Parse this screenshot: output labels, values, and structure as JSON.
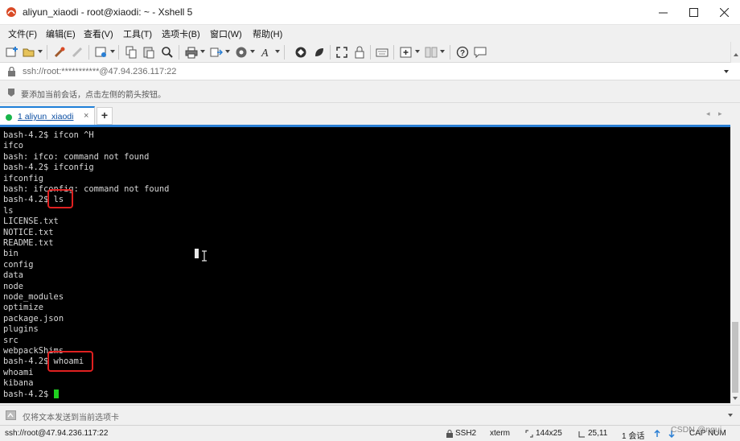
{
  "window": {
    "title": "aliyun_xiaodi - root@xiaodi: ~ - Xshell 5",
    "minimize_glyph": "—",
    "maximize_glyph": "☐",
    "close_glyph": "✕"
  },
  "menu": {
    "items": [
      "文件(F)",
      "编辑(E)",
      "查看(V)",
      "工具(T)",
      "选项卡(B)",
      "窗口(W)",
      "帮助(H)"
    ]
  },
  "toolbar": {
    "icons": [
      "new-session-icon",
      "open-folder-icon",
      "reconnect-icon",
      "disconnect-icon",
      "properties-icon",
      "copy-icon",
      "paste-icon",
      "find-icon",
      "print-icon",
      "transfer-icon",
      "script-icon",
      "font-icon",
      "xftp-icon",
      "xmanager-icon",
      "fullscreen-icon",
      "lock-icon",
      "keyboard-icon",
      "add-tab-icon",
      "layout-icon",
      "help-icon",
      "chat-icon"
    ]
  },
  "address": {
    "url": "ssh://root:***********@47.94.236.117:22"
  },
  "hint": {
    "text": "要添加当前会话，点击左侧的箭头按钮。"
  },
  "tabs": {
    "active_label": "1 aliyun_xiaodi",
    "close_glyph": "×",
    "add_glyph": "+",
    "prev_glyph": "◂",
    "next_glyph": "▸"
  },
  "terminal": {
    "lines": [
      "bash-4.2$ ifcon ^H",
      "ifco",
      "bash: ifco: command not found",
      "bash-4.2$ ifconfig",
      "ifconfig",
      "bash: ifconfig: command not found",
      "bash-4.2$ ls",
      "ls",
      "LICENSE.txt",
      "NOTICE.txt",
      "README.txt",
      "bin",
      "config",
      "data",
      "node",
      "node_modules",
      "optimize",
      "package.json",
      "plugins",
      "src",
      "webpackShims",
      "bash-4.2$ whoami",
      "whoami",
      "kibana",
      "bash-4.2$ "
    ],
    "highlights": [
      "ls",
      "whoami"
    ],
    "cursor_color": "#1fd11f",
    "highlight_color": "#e02020"
  },
  "compose": {
    "text": "仅将文本发送到当前选项卡"
  },
  "status": {
    "connection": "ssh://root@47.94.236.117:22",
    "protocol": "SSH2",
    "terminal_type": "xterm",
    "size": "144x25",
    "cursor_pos": "25,11",
    "sessions": "1 会话",
    "caps": "CAP",
    "num": "NUM"
  },
  "watermark": {
    "text": "CSDN @ngui"
  },
  "colors": {
    "accent": "#2a7fd4",
    "terminal_bg": "#000000",
    "terminal_fg": "#d8d8d8",
    "status_dot": "#19b54a"
  }
}
